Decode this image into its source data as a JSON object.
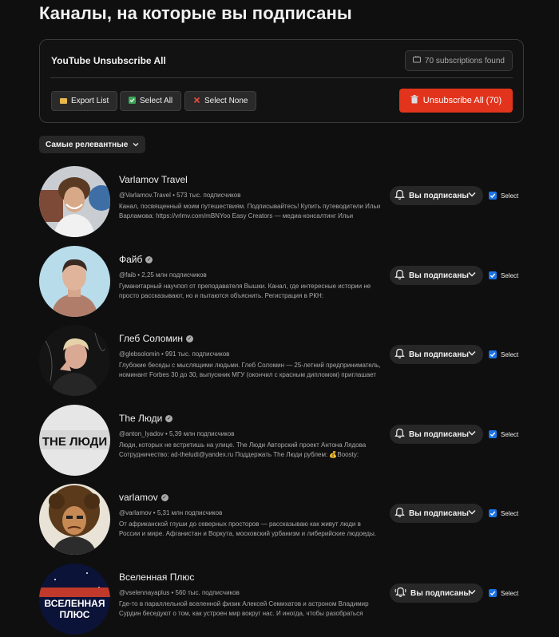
{
  "page": {
    "title": "Каналы, на которые вы подписаны"
  },
  "panel": {
    "title": "YouTube Unsubscribe All",
    "found": "70 subscriptions found",
    "export_label": "Export List",
    "select_all_label": "Select All",
    "select_none_label": "Select None",
    "unsubscribe_all_label": "Unsubscribe All (70)",
    "colors": {
      "danger": "#e2341c",
      "accent": "#1a73e8"
    }
  },
  "sort": {
    "label": "Самые релевантные"
  },
  "channels": [
    {
      "name": "Varlamov Travel",
      "verified": false,
      "meta": "@Varlamov.Travel • 573 тыс. подписчиков",
      "desc1": "Канал, посвященный моим путешествиям. Подписывайтесь! Купить путеводители Ильи",
      "desc2": "Варламова: https://vrlmv.com/mBNYoo Easy Creators — медиа-консалтинг Ильи",
      "subscribed_label": "Вы подписаны",
      "select_label": "Select",
      "bell": "bell-icon"
    },
    {
      "name": "Файб",
      "verified": true,
      "meta": "@faib • 2,25 млн подписчиков",
      "desc1": "Гуманитарный научпоп от преподавателя Вышки. Канал, где интересные истории не",
      "desc2": "просто рассказывают, но и пытаются объяснить. Регистрация в РКН:",
      "subscribed_label": "Вы подписаны",
      "select_label": "Select",
      "bell": "bell-icon"
    },
    {
      "name": "Глеб Соломин",
      "verified": true,
      "meta": "@glebsolomin • 991 тыс. подписчиков",
      "desc1": "Глубокие беседы с мыслящими людьми. Глеб Соломин — 25-летний предприниматель,",
      "desc2": "номинант Forbes 30 до 30, выпускник МГУ (окончил с красным дипломом) приглашает",
      "subscribed_label": "Вы подписаны",
      "select_label": "Select",
      "bell": "bell-icon"
    },
    {
      "name": "The Люди",
      "verified": true,
      "meta": "@anton_lyadov • 5,39 млн подписчиков",
      "desc1": "Люди, которых не встретишь на улице. The Люди Авторский проект Антона Лядова",
      "desc2": "Сотрудничество: ad-theludi@yandex.ru Поддержать The Люди рублем: 💰Boosty:",
      "subscribed_label": "Вы подписаны",
      "select_label": "Select",
      "bell": "bell-icon",
      "avatar_text": "THE ЛЮДИ"
    },
    {
      "name": "varlamov",
      "verified": true,
      "meta": "@varlamov • 5,31 млн подписчиков",
      "desc1": "От африканской глуши до северных просторов — рассказываю как живут люди в",
      "desc2": "России и мире. Афганистан и Воркута, московский урбанизм и либерийские людоеды.",
      "subscribed_label": "Вы подписаны",
      "select_label": "Select",
      "bell": "bell-icon"
    },
    {
      "name": "Вселенная Плюс",
      "verified": false,
      "meta": "@vselennayaplus • 560 тыс. подписчиков",
      "desc1": "Где-то в параллельной вселенной физик Алексей Семихатов и астроном Владимир",
      "desc2": "Сурдин беседуют о том, как устроен мир вокруг нас. И иногда, чтобы разобраться",
      "subscribed_label": "Вы подписаны",
      "select_label": "Select",
      "bell": "bell-ringing-icon",
      "avatar_text1": "ВСЕЛЕННАЯ",
      "avatar_text2": "ПЛЮС"
    }
  ]
}
